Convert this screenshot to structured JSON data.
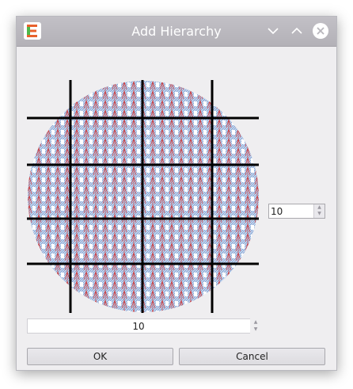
{
  "window": {
    "title": "Add Hierarchy",
    "icons": {
      "app": "app-logo-icon",
      "minimize": "chevron-down-icon",
      "maximize": "chevron-up-icon",
      "close": "close-icon"
    }
  },
  "wafer_preview": {
    "colors": {
      "die_fill": "#9fbbe0",
      "die_stroke": "#d23a3a",
      "grid_lines": "#000000",
      "background": "#ffffff"
    }
  },
  "vertical_divisions": {
    "value": "10"
  },
  "horizontal_divisions": {
    "value": "10"
  },
  "buttons": {
    "ok": "OK",
    "cancel": "Cancel"
  },
  "colors": {
    "titlebar": "#b7b5bb",
    "dialog_bg": "#efeef0",
    "logo_green": "#4fb84a",
    "logo_orange": "#e8612c"
  }
}
